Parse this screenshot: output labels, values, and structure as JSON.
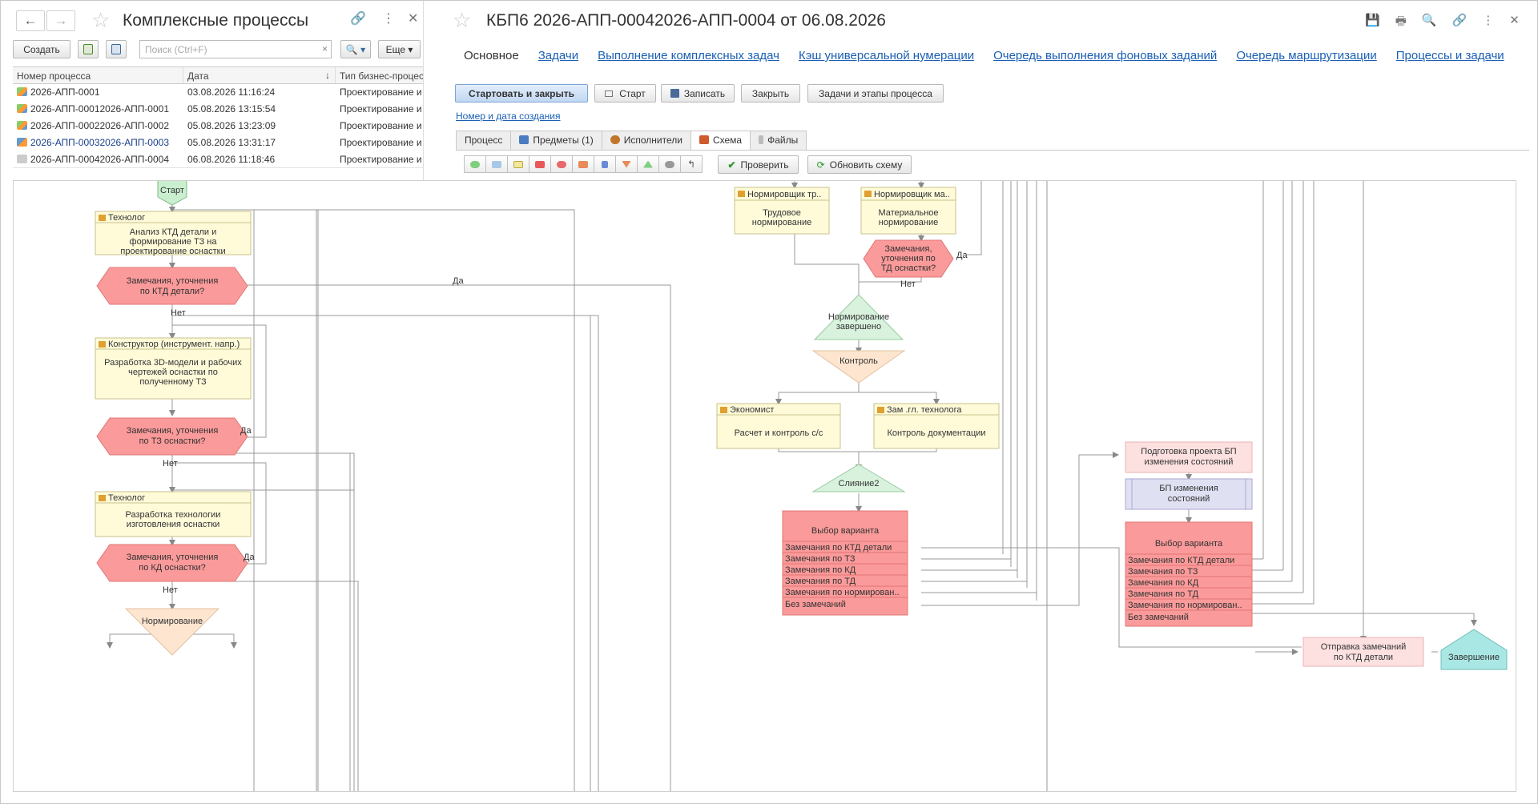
{
  "left_pane": {
    "title": "Комплексные процессы",
    "back": "←",
    "forward": "→",
    "link_icon": "🔗",
    "more_icon": "⋮",
    "close_icon": "✕",
    "create_button": "Создать",
    "search_placeholder": "Поиск (Ctrl+F)",
    "search_clear": "×",
    "search_button": "🔍 ▾",
    "more_button": "Еще ▾",
    "columns": [
      "Номер процесса",
      "Дата",
      "Тип бизнес-процес"
    ],
    "rows": [
      {
        "number": "2026-АПП-0001",
        "date": "03.08.2026 11:16:24",
        "type": "Проектирование и"
      },
      {
        "number": "2026-АПП-00012026-АПП-0001",
        "date": "05.08.2026 13:15:54",
        "type": "Проектирование и"
      },
      {
        "number": "2026-АПП-00022026-АПП-0002",
        "date": "05.08.2026 13:23:09",
        "type": "Проектирование и"
      },
      {
        "number": "2026-АПП-00032026-АПП-0003",
        "date": "05.08.2026 13:31:17",
        "type": "Проектирование и"
      },
      {
        "number": "2026-АПП-00042026-АПП-0004",
        "date": "06.08.2026 11:18:46",
        "type": "Проектирование и"
      }
    ]
  },
  "right_pane": {
    "title": "КБП6 2026-АПП-00042026-АПП-0004 от 06.08.2026",
    "tabs": [
      "Основное",
      "Задачи",
      "Выполнение комплексных задач",
      "Кэш универсальной нумерации",
      "Очередь выполнения фоновых заданий",
      "Очередь маршрутизации",
      "Процессы и задачи"
    ],
    "buttons": {
      "start_close": "Стартовать и закрыть",
      "start": "Старт",
      "save": "Записать",
      "close": "Закрыть",
      "tasks": "Задачи и этапы процесса"
    },
    "link": "Номер и дата создания",
    "inner_tabs": [
      "Процесс",
      "Предметы (1)",
      "Исполнители",
      "Схема",
      "Файлы"
    ],
    "check_button": "Проверить",
    "refresh_button": "Обновить схему"
  },
  "diagram": {
    "start": "Старт",
    "end": "Завершение",
    "yes": "Да",
    "no": "Нет",
    "t1_role": "Технолог",
    "t1_text": [
      "Анализ КТД детали и",
      "формирование ТЗ на",
      "проектирование оснастки"
    ],
    "c1": [
      "Замечания, уточнения",
      "по КТД детали?"
    ],
    "t2_role": "Конструктор (инструмент. напр.)",
    "t2_text": [
      "Разработка 3D-модели и рабочих",
      "чертежей оснастки по",
      "полученному ТЗ"
    ],
    "c2": [
      "Замечания, уточнения",
      "по ТЗ оснастки?"
    ],
    "t3_role": "Технолог",
    "t3_text": [
      "Разработка технологии",
      "изготовления оснастки"
    ],
    "c3": [
      "Замечания, уточнения",
      "по КД оснастки?"
    ],
    "split1": "Нормирование",
    "t4_role": "Нормировщик тр..",
    "t4_text": [
      "Трудовое",
      "нормирование"
    ],
    "t5_role": "Нормировщик ма..",
    "t5_text": [
      "Материальное",
      "нормирование"
    ],
    "c4": [
      "Замечания,",
      "уточнения по",
      "ТД оснастки?"
    ],
    "merge1": [
      "Нормирование",
      "завершено"
    ],
    "split2": "Контроль",
    "t6_role": "Экономист",
    "t6_text": "Расчет и контроль с/с",
    "t7_role": "Зам .гл. технолога",
    "t7_text": "Контроль документации",
    "merge2": "Слияние2",
    "choice1_title": "Выбор варианта",
    "choice1_items": [
      "Замечания по КТД детали",
      "Замечания по ТЗ",
      "Замечания по КД",
      "Замечания по ТД",
      "Замечания по нормирован..",
      "Без замечаний"
    ],
    "prep": [
      "Подготовка проекта БП",
      "изменения состояний"
    ],
    "subproc": [
      "БП изменения",
      "состояний"
    ],
    "choice2_title": "Выбор варианта",
    "choice2_items": [
      "Замечания по КТД детали",
      "Замечания по ТЗ",
      "Замечания по КД",
      "Замечания по ТД",
      "Замечания по нормирован..",
      "Без замечаний"
    ],
    "send": [
      "Отправка замечаний",
      "по КТД детали"
    ]
  }
}
